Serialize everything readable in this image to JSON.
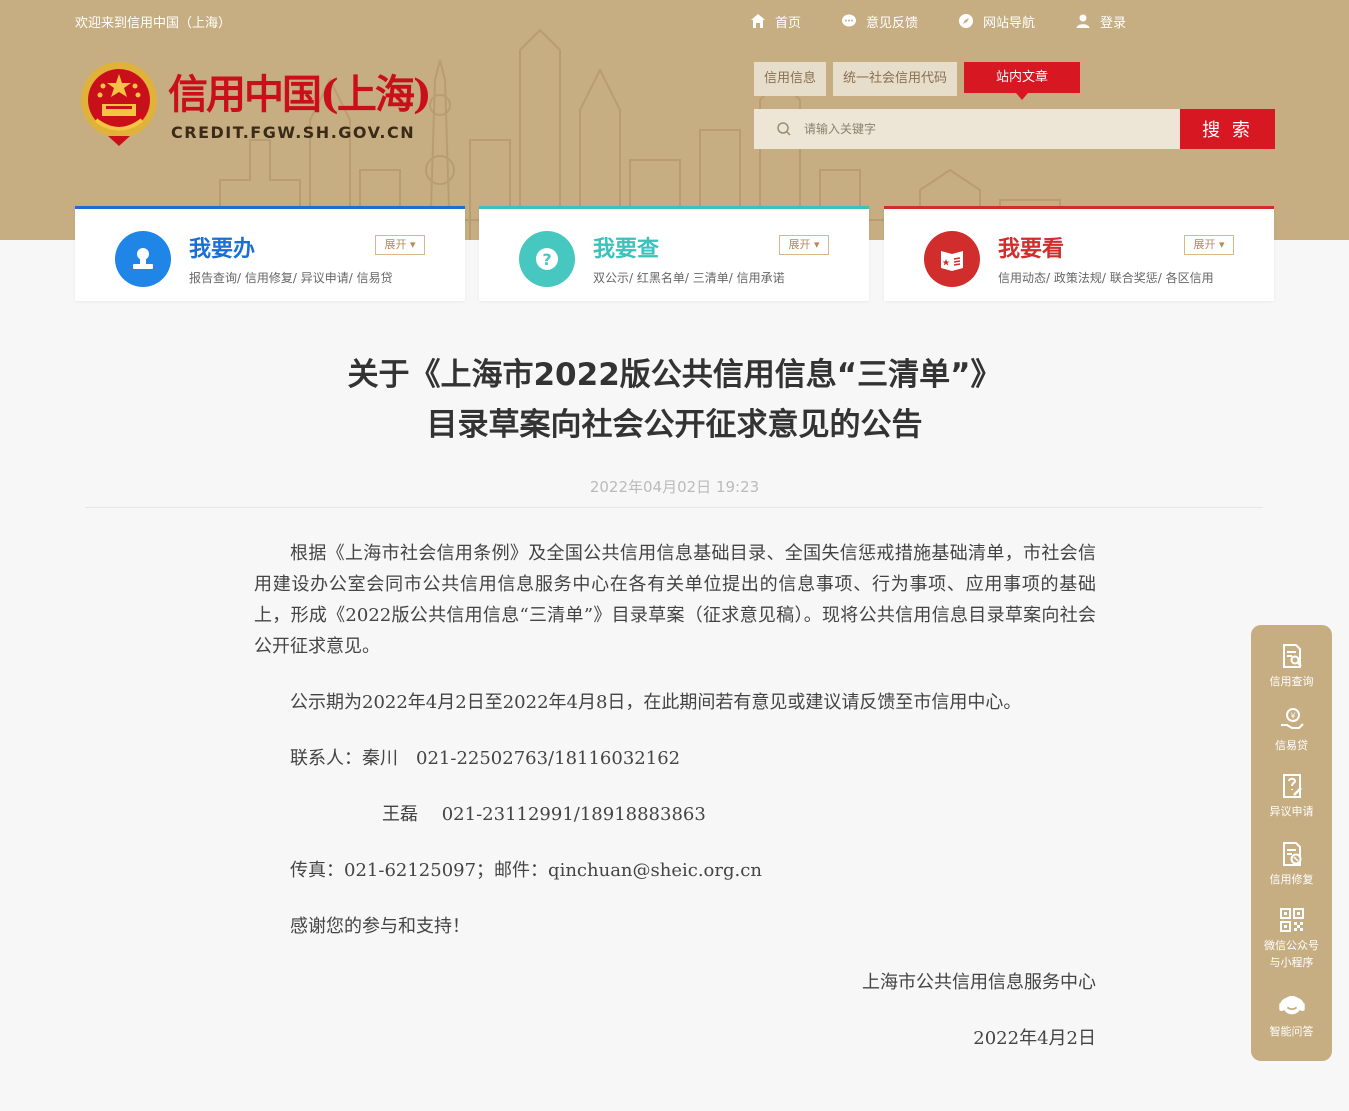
{
  "topbar": {
    "welcome": "欢迎来到信用中国（上海）",
    "nav": [
      {
        "label": "首页",
        "icon": "home-icon"
      },
      {
        "label": "意见反馈",
        "icon": "chat-icon"
      },
      {
        "label": "网站导航",
        "icon": "compass-icon"
      },
      {
        "label": "登录",
        "icon": "user-icon"
      }
    ]
  },
  "logo": {
    "title": "信用中国(上海)",
    "url": "CREDIT.FGW.SH.GOV.CN"
  },
  "search": {
    "tabs": [
      "信用信息",
      "统一社会信用代码",
      "站内文章"
    ],
    "active_tab": "站内文章",
    "placeholder": "请输入关键字",
    "button": "搜 索"
  },
  "cards": [
    {
      "title": "我要办",
      "links": "报告查询/ 信用修复/ 异议申请/ 信易贷",
      "expand": "展开 ▾",
      "color": "#1a6fd6",
      "icon": "stamp-icon"
    },
    {
      "title": "我要查",
      "links": "双公示/ 红黑名单/ 三清单/ 信用承诺",
      "expand": "展开 ▾",
      "color": "#3cc2bd",
      "icon": "question-icon"
    },
    {
      "title": "我要看",
      "links": "信用动态/ 政策法规/ 联合奖惩/ 各区信用",
      "expand": "展开 ▾",
      "color": "#d22d2d",
      "icon": "book-icon"
    }
  ],
  "article": {
    "title_line1": "关于《上海市2022版公共信用信息“三清单”》",
    "title_line2": "目录草案向社会公开征求意见的公告",
    "date": "2022年04月02日 19:23",
    "para1": "根据《上海市社会信用条例》及全国公共信用信息基础目录、全国失信惩戒措施基础清单，市社会信用建设办公室会同市公共信用信息服务中心在各有关单位提出的信息事项、行为事项、应用事项的基础上，形成《2022版公共信用信息“三清单”》目录草案（征求意见稿）。现将公共信用信息目录草案向社会公开征求意见。",
    "para2": "公示期为2022年4月2日至2022年4月8日，在此期间若有意见或建议请反馈至市信用中心。",
    "contact1": "联系人：秦川　021-22502763/18116032162",
    "contact2": "王磊　 021-23112991/18918883863",
    "fax": "传真：021-62125097；邮件：qinchuan@sheic.org.cn",
    "thanks": "感谢您的参与和支持！",
    "signature": "上海市公共信用信息服务中心",
    "sign_date": "2022年4月2日"
  },
  "sidebar": {
    "items": [
      {
        "label": "信用查询",
        "icon": "document-search-icon"
      },
      {
        "label": "信易贷",
        "icon": "hand-coin-icon"
      },
      {
        "label": "异议申请",
        "icon": "document-edit-icon"
      },
      {
        "label": "信用修复",
        "icon": "document-repair-icon"
      },
      {
        "label": "微信公众号",
        "label2": "与小程序",
        "icon": "qrcode-icon"
      },
      {
        "label": "智能问答",
        "icon": "headset-icon"
      }
    ]
  },
  "colors": {
    "header": "#c6ae82",
    "accent_red": "#d71721"
  }
}
